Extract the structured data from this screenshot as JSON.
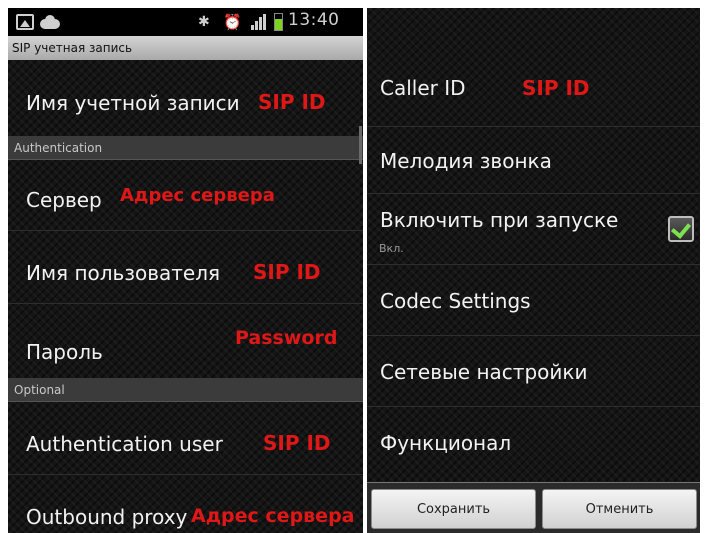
{
  "statusbar": {
    "time": "13:40",
    "icons": [
      "gallery-icon",
      "cloud-icon",
      "nfc-icon",
      "alarm-icon",
      "signal-icon",
      "battery-icon"
    ]
  },
  "left": {
    "title": "SIP учетная запись",
    "account_label": "Имя учетной записи",
    "account_value": "SIP ID",
    "section_auth": "Authentication",
    "server_label": "Сервер",
    "server_value": "Адрес сервера",
    "user_label": "Имя пользователя",
    "user_value": "SIP ID",
    "password_label": "Пароль",
    "password_value": "Password",
    "section_optional": "Optional",
    "authuser_label": "Authentication user",
    "authuser_value": "SIP ID",
    "proxy_label": "Outbound proxy",
    "proxy_value": "Адрес сервера"
  },
  "right": {
    "caller_label": "Caller ID",
    "caller_value": "SIP ID",
    "ringtone_label": "Мелодия звонка",
    "autostart_label": "Включить при запуске",
    "autostart_sub": "Вкл.",
    "autostart_checked": true,
    "codec_label": "Codec Settings",
    "network_label": "Сетевые настройки",
    "features_label": "Функционал",
    "save_button": "Сохранить",
    "cancel_button": "Отменить"
  },
  "colors": {
    "accent_red": "#e01717",
    "check_green": "#7fe04f"
  }
}
